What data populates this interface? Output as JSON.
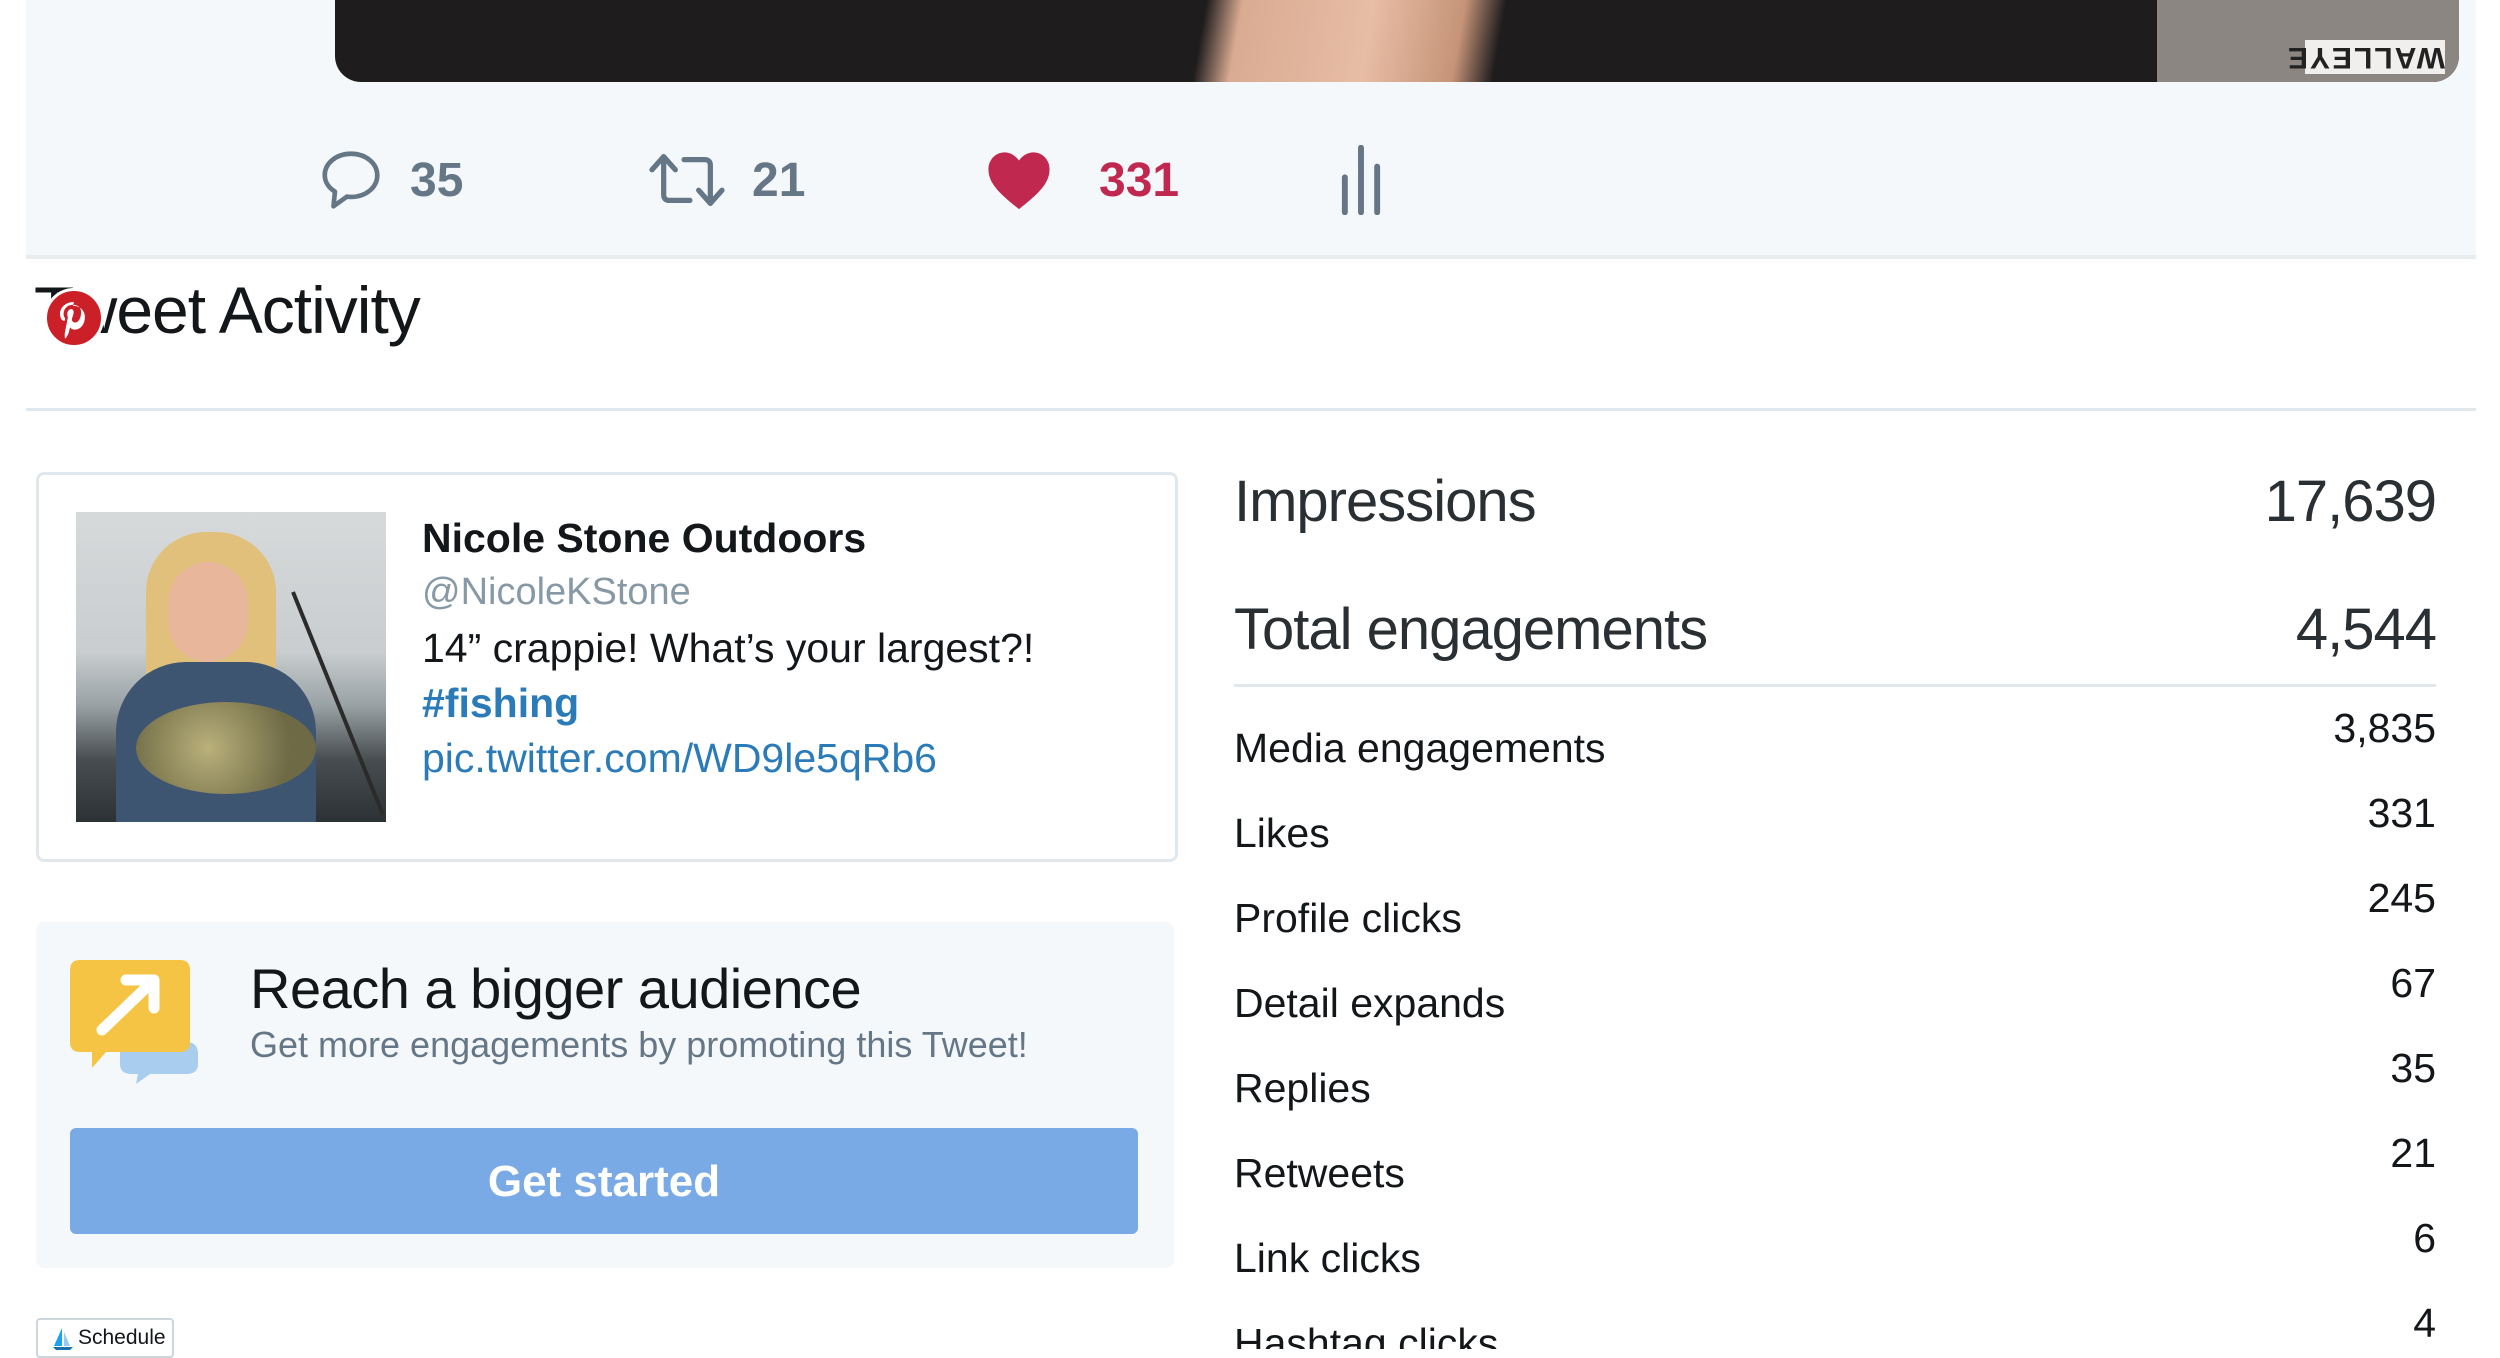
{
  "media": {
    "sign_text": "WALLEYE"
  },
  "actions": {
    "replies": "35",
    "retweets": "21",
    "likes": "331"
  },
  "colors": {
    "like": "#c0284f",
    "link": "#2b7bb9",
    "button": "#7aaae6",
    "pinterest": "#cb2027"
  },
  "section_title": "Tweet Activity",
  "tweet_card": {
    "name": "Nicole Stone Outdoors",
    "handle": "@NicoleKStone",
    "text": "14” crappie! What’s your largest?!",
    "hashtag": "#fishing",
    "link": "pic.twitter.com/WD9le5qRb6"
  },
  "promo": {
    "title": "Reach a bigger audience",
    "subtitle": "Get more engagements by promoting this Tweet!",
    "button": "Get started"
  },
  "schedule": {
    "label": "Schedule"
  },
  "stats": {
    "impressions": {
      "label": "Impressions",
      "value": "17,639"
    },
    "total": {
      "label": "Total engagements",
      "value": "4,544"
    },
    "rows": [
      {
        "label": "Media engagements",
        "value": "3,835"
      },
      {
        "label": "Likes",
        "value": "331"
      },
      {
        "label": "Profile clicks",
        "value": "245"
      },
      {
        "label": "Detail expands",
        "value": "67"
      },
      {
        "label": "Replies",
        "value": "35"
      },
      {
        "label": "Retweets",
        "value": "21"
      },
      {
        "label": "Link clicks",
        "value": "6"
      },
      {
        "label": "Hashtag clicks",
        "value": "4"
      }
    ]
  },
  "icons": [
    "reply-icon",
    "retweet-icon",
    "heart-icon",
    "analytics-icon",
    "pinterest-icon",
    "promote-icon",
    "schedule-icon"
  ]
}
